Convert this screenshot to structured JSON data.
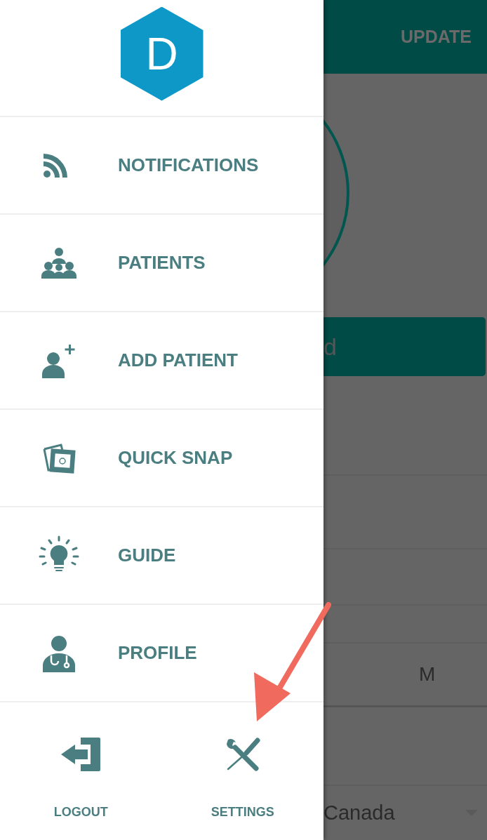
{
  "logo": {
    "letter": "D"
  },
  "menu": [
    {
      "kind": "feed",
      "label": "NOTIFICATIONS"
    },
    {
      "kind": "group",
      "label": "PATIENTS"
    },
    {
      "kind": "add-person",
      "label": "ADD PATIENT"
    },
    {
      "kind": "photos",
      "label": "QUICK SNAP"
    },
    {
      "kind": "bulb",
      "label": "GUIDE"
    },
    {
      "kind": "doctor",
      "label": "PROFILE"
    }
  ],
  "footer": [
    {
      "kind": "logout",
      "label": "LOGOUT"
    },
    {
      "kind": "tools",
      "label": "SETTINGS"
    }
  ],
  "background": {
    "action": "UPDATE",
    "button_text": "d",
    "field_value": "M",
    "select_value": "Canada"
  }
}
